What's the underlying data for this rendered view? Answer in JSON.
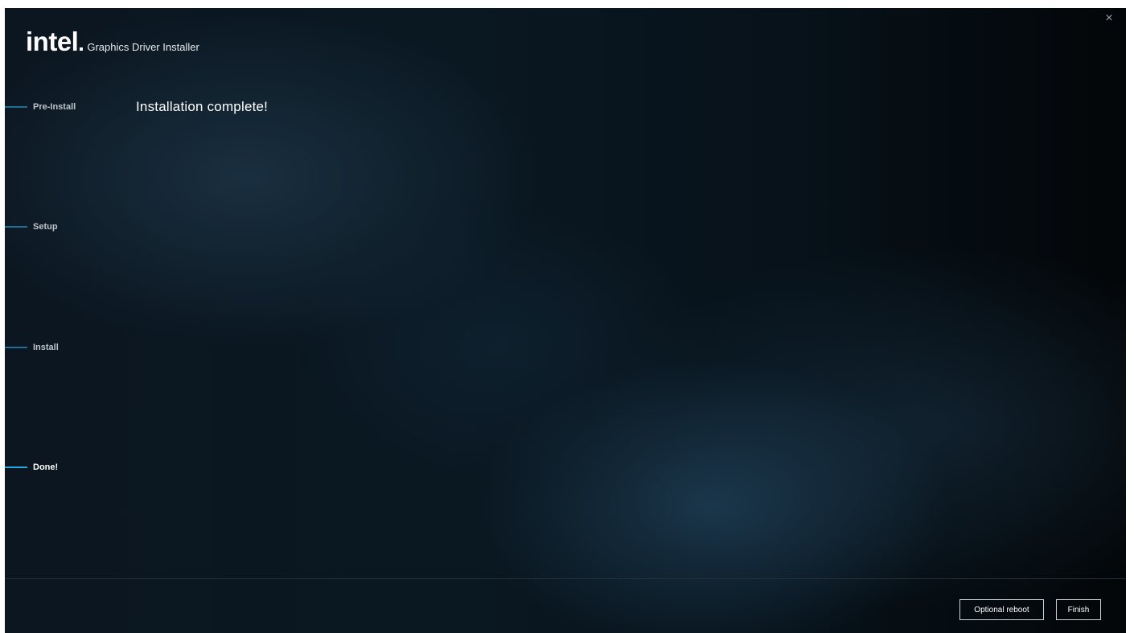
{
  "app": {
    "logo_text": "intel",
    "title": "Graphics Driver Installer",
    "close_glyph": "×"
  },
  "steps": [
    {
      "label": "Pre-Install",
      "active": false
    },
    {
      "label": "Setup",
      "active": false
    },
    {
      "label": "Install",
      "active": false
    },
    {
      "label": "Done!",
      "active": true
    }
  ],
  "main": {
    "heading": "Installation complete!"
  },
  "footer": {
    "optional_reboot_label": "Optional reboot",
    "finish_label": "Finish"
  },
  "colors": {
    "accent_active": "#22a9e0",
    "accent_inactive": "#1f6f93",
    "background": "#0a1822"
  }
}
